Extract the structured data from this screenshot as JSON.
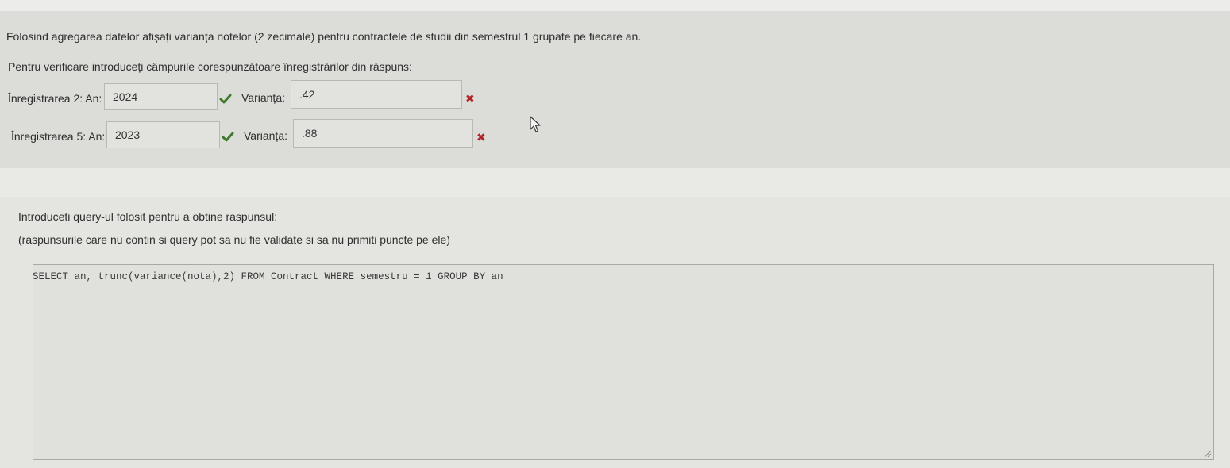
{
  "question": {
    "prompt": "Folosind agregarea datelor afișați varianța notelor (2 zecimale) pentru contractele de studii din semestrul 1 grupate pe fiecare an.",
    "instruction": "Pentru verificare introduceți câmpurile corespunzătoare înregistrărilor din răspuns:"
  },
  "records": [
    {
      "label": "Înregistrarea 2: An:",
      "year_value": "2024",
      "year_status": "correct",
      "variance_label": "Varianța:",
      "variance_value": ".42",
      "variance_status": "wrong"
    },
    {
      "label": "Înregistrarea 5: An:",
      "year_value": "2023",
      "year_status": "correct",
      "variance_label": "Varianța:",
      "variance_value": ".88",
      "variance_status": "wrong"
    }
  ],
  "query_section": {
    "label": "Introduceti query-ul folosit pentru a obtine raspunsul:",
    "note": "(raspunsurile care nu contin si query pot sa nu fie validate si sa nu primiti puncte pe ele)",
    "query_text": "SELECT an, trunc(variance(nota),2) FROM Contract WHERE semestru = 1 GROUP BY an"
  },
  "colors": {
    "check_green": "#3d7a2a",
    "cross_red": "#b0272a"
  },
  "icons": {
    "correct": "check-icon",
    "wrong": "cross-icon",
    "pointer": "mouse-cursor-icon",
    "resize": "resize-handle-icon"
  }
}
